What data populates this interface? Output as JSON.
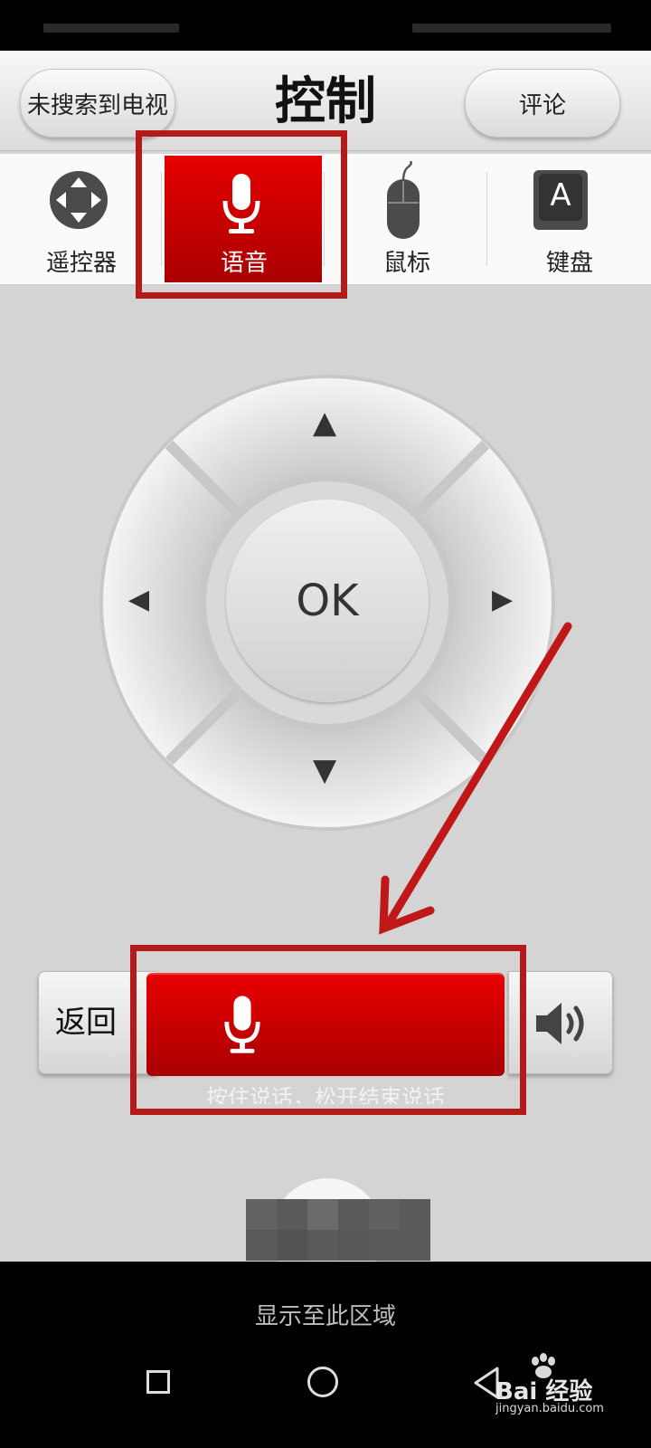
{
  "header": {
    "left_button": "未搜索到电视",
    "title": "控制",
    "right_button": "评论"
  },
  "tabs": [
    {
      "label": "遥控器",
      "icon": "dpad-icon",
      "selected": false
    },
    {
      "label": "语音",
      "icon": "microphone-icon",
      "selected": true
    },
    {
      "label": "鼠标",
      "icon": "mouse-icon",
      "selected": false
    },
    {
      "label": "键盘",
      "icon": "keyboard-icon",
      "key_letter": "A",
      "selected": false
    }
  ],
  "dpad": {
    "ok_label": "OK",
    "up_glyph": "▲",
    "down_glyph": "▼",
    "left_glyph": "◀",
    "right_glyph": "▶"
  },
  "voice_bar": {
    "back_label": "返回",
    "hint": "按住说话，松开结束说话",
    "speaker_icon": "speaker-icon"
  },
  "bottom": {
    "display_text": "显示至此区域"
  },
  "watermark": {
    "text": "Bai 经验",
    "url": "jingyan.baidu.com"
  },
  "colors": {
    "accent_red": "#d40000",
    "annotation_red": "#b31b1b",
    "background": "#d4d4d4"
  }
}
